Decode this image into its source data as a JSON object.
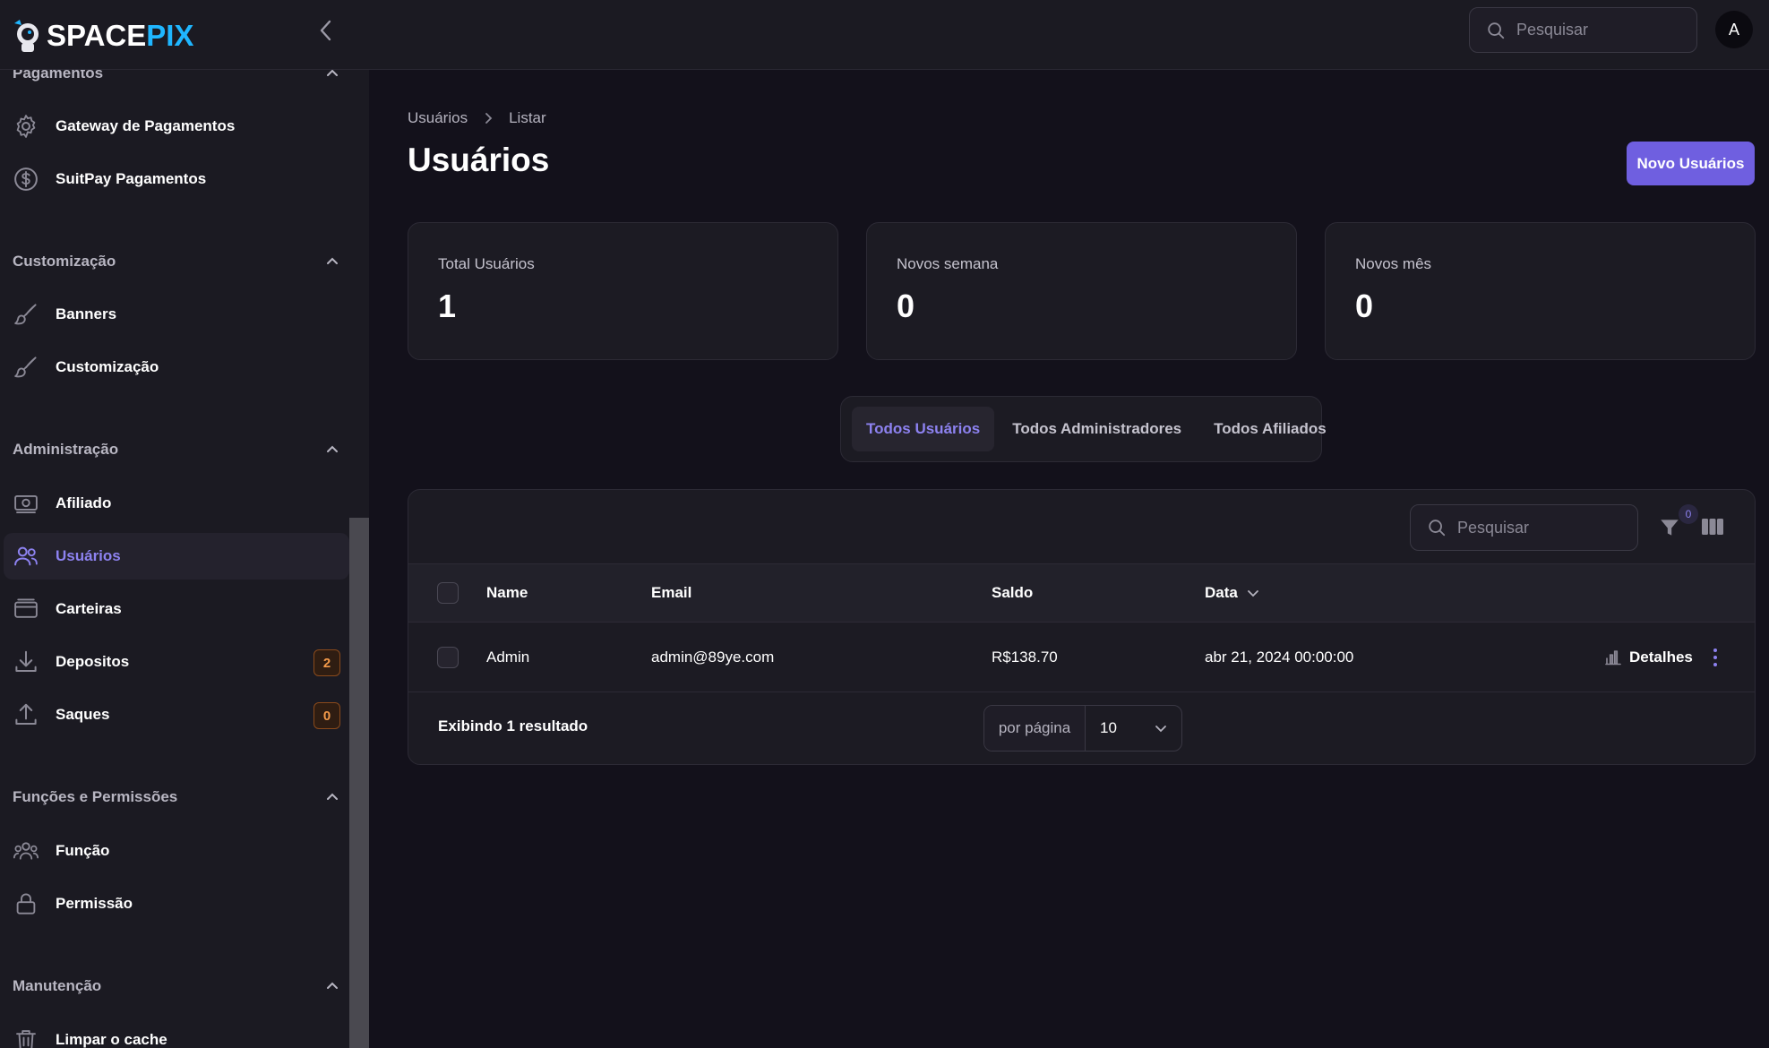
{
  "brand": {
    "part1": "SPACE",
    "part2": "PIX"
  },
  "topbar": {
    "search_placeholder": "Pesquisar",
    "avatar_initial": "A"
  },
  "sidebar": {
    "groups": [
      {
        "title": "Pagamentos",
        "items": [
          {
            "label": "Gateway de Pagamentos",
            "icon": "gear-icon"
          },
          {
            "label": "SuitPay Pagamentos",
            "icon": "dollar-circle-icon"
          }
        ]
      },
      {
        "title": "Customização",
        "items": [
          {
            "label": "Banners",
            "icon": "paintbrush-icon"
          },
          {
            "label": "Customização",
            "icon": "paintbrush-icon"
          }
        ]
      },
      {
        "title": "Administração",
        "items": [
          {
            "label": "Afiliado",
            "icon": "cash-icon"
          },
          {
            "label": "Usuários",
            "icon": "users-icon",
            "active": true
          },
          {
            "label": "Carteiras",
            "icon": "wallet-icon"
          },
          {
            "label": "Depositos",
            "icon": "download-icon",
            "badge": "2"
          },
          {
            "label": "Saques",
            "icon": "upload-icon",
            "badge": "0"
          }
        ]
      },
      {
        "title": "Funções e Permissões",
        "items": [
          {
            "label": "Função",
            "icon": "user-group-icon"
          },
          {
            "label": "Permissão",
            "icon": "lock-icon"
          }
        ]
      },
      {
        "title": "Manutenção",
        "items": [
          {
            "label": "Limpar o cache",
            "icon": "trash-icon"
          }
        ]
      }
    ]
  },
  "breadcrumb": {
    "first": "Usuários",
    "second": "Listar"
  },
  "page": {
    "title": "Usuários",
    "new_button": "Novo Usuários"
  },
  "stats": [
    {
      "label": "Total Usuários",
      "value": "1"
    },
    {
      "label": "Novos semana",
      "value": "0"
    },
    {
      "label": "Novos mês",
      "value": "0"
    }
  ],
  "tabs": [
    {
      "label": "Todos Usuários",
      "active": true
    },
    {
      "label": "Todos Administradores"
    },
    {
      "label": "Todos Afiliados"
    }
  ],
  "table": {
    "search_placeholder": "Pesquisar",
    "filter_count": "0",
    "columns": {
      "name": "Name",
      "email": "Email",
      "saldo": "Saldo",
      "data": "Data"
    },
    "rows": [
      {
        "name": "Admin",
        "email": "admin@89ye.com",
        "saldo": "R$138.70",
        "data": "abr 21, 2024 00:00:00",
        "action": "Detalhes"
      }
    ],
    "result_text": "Exibindo 1 resultado",
    "per_page_label": "por página",
    "per_page_value": "10"
  },
  "colors": {
    "accent": "#6f5fe0",
    "accent_text": "#8d82f0",
    "brand_blue": "#1fb6ff",
    "badge_orange": "#f39a4a"
  }
}
